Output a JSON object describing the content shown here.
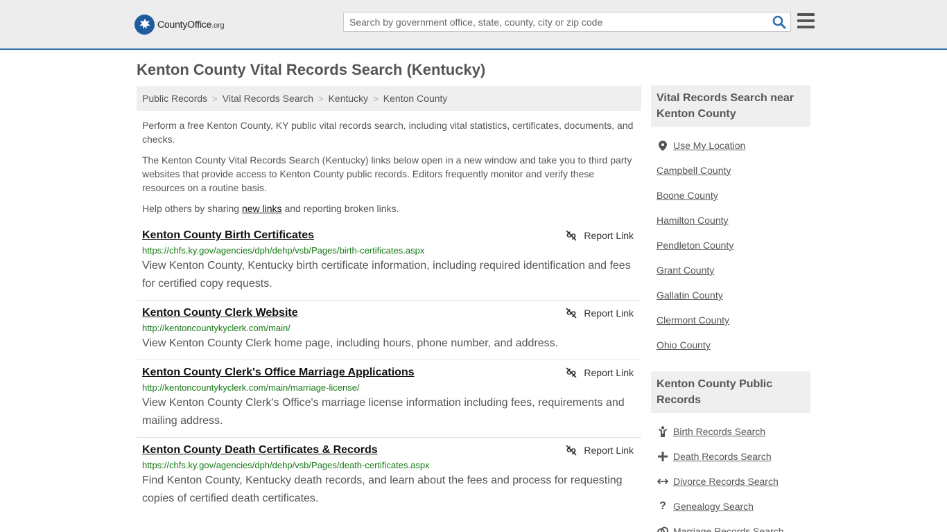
{
  "header": {
    "logo_name": "CountyOffice",
    "logo_tld": ".org",
    "search_placeholder": "Search by government office, state, county, city or zip code"
  },
  "page": {
    "title": "Kenton County Vital Records Search (Kentucky)"
  },
  "breadcrumb": [
    "Public Records",
    "Vital Records Search",
    "Kentucky",
    "Kenton County"
  ],
  "intro": {
    "p1": "Perform a free Kenton County, KY public vital records search, including vital statistics, certificates, documents, and checks.",
    "p2": "The Kenton County Vital Records Search (Kentucky) links below open in a new window and take you to third party websites that provide access to Kenton County public records. Editors frequently monitor and verify these resources on a routine basis.",
    "p3_before": "Help others by sharing ",
    "p3_link": "new links",
    "p3_after": " and reporting broken links."
  },
  "report_label": "Report Link",
  "records": [
    {
      "title": "Kenton County Birth Certificates",
      "url": "https://chfs.ky.gov/agencies/dph/dehp/vsb/Pages/birth-certificates.aspx",
      "desc": "View Kenton County, Kentucky birth certificate information, including required identification and fees for certified copy requests."
    },
    {
      "title": "Kenton County Clerk Website",
      "url": "http://kentoncountykyclerk.com/main/",
      "desc": "View Kenton County Clerk home page, including hours, phone number, and address."
    },
    {
      "title": "Kenton County Clerk's Office Marriage Applications",
      "url": "http://kentoncountykyclerk.com/main/marriage-license/",
      "desc": "View Kenton County Clerk's Office's marriage license information including fees, requirements and mailing address."
    },
    {
      "title": "Kenton County Death Certificates & Records",
      "url": "https://chfs.ky.gov/agencies/dph/dehp/vsb/Pages/death-certificates.aspx",
      "desc": "Find Kenton County, Kentucky death records, and learn about the fees and process for requesting copies of certified death certificates."
    }
  ],
  "sidebar": {
    "nearby_title": "Vital Records Search near Kenton County",
    "use_location": "Use My Location",
    "nearby": [
      "Campbell County",
      "Boone County",
      "Hamilton County",
      "Pendleton County",
      "Grant County",
      "Gallatin County",
      "Clermont County",
      "Ohio County"
    ],
    "public_title": "Kenton County Public Records",
    "public_links": [
      {
        "label": "Birth Records Search",
        "icon": "child-icon"
      },
      {
        "label": "Death Records Search",
        "icon": "cross-icon"
      },
      {
        "label": "Divorce Records Search",
        "icon": "split-arrows-icon"
      },
      {
        "label": "Genealogy Search",
        "icon": "question-icon"
      },
      {
        "label": "Marriage Records Search",
        "icon": "rings-icon"
      }
    ]
  },
  "colors": {
    "accent": "#2f6fb2",
    "url_green": "#157a15",
    "text": "#555555"
  }
}
